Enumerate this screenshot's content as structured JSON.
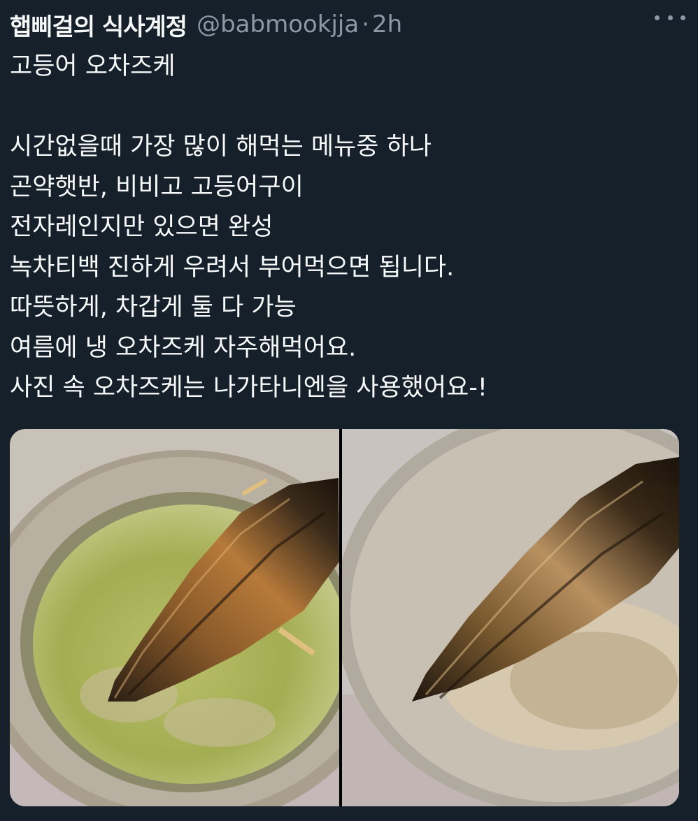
{
  "tweet": {
    "display_name": "햅삐걸의 식사계정",
    "handle": "@babmookjja",
    "separator": "·",
    "time": "2h",
    "lines": [
      "고등어 오차즈케",
      "",
      "시간없을때 가장 많이 해먹는 메뉴중 하나",
      "곤약햇반, 비비고 고등어구이",
      "전자레인지만 있으면 완성",
      "녹차티백 진하게 우려서 부어먹으면 됩니다.",
      "따뜻하게, 차갑게 둘 다 가능",
      "여름에 냉 오차즈케 자주해먹어요.",
      "사진 속 오차즈케는 나가타니엔을 사용했어요-!"
    ]
  },
  "icons": {
    "more": "more-horizontal-icon"
  },
  "colors": {
    "background": "#15202b",
    "text_primary": "#f7f9f9",
    "text_secondary": "#8b98a5"
  }
}
